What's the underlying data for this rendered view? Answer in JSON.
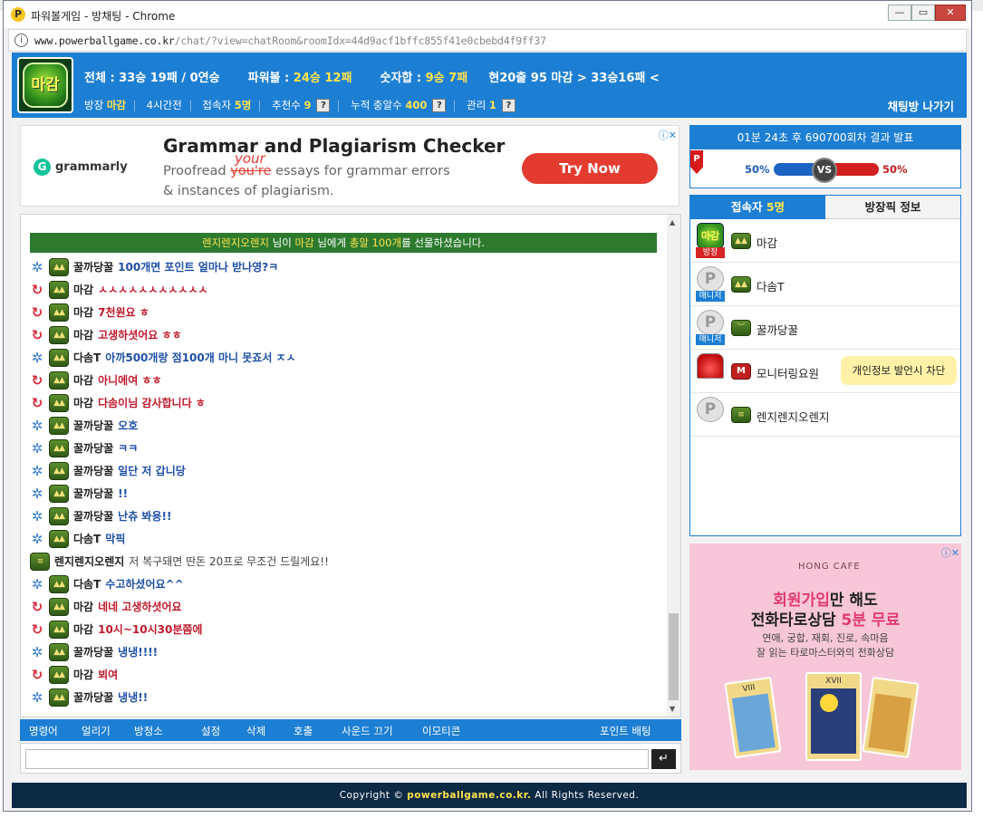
{
  "window": {
    "title": "파워볼게임 - 방채팅 - Chrome",
    "url_host": "www.powerballgame.co.kr",
    "url_path": "/chat/?view=chatRoom&roomIdx=44d9acf1bffc855f41e0cbebd4f9ff37",
    "min_glyph": "—",
    "max_glyph": "▭",
    "close_glyph": "✕"
  },
  "header": {
    "logo_text": "마감",
    "stat_total_label": "전체 : ",
    "stat_total_value": "33승 19패 / 0연승",
    "stat_powerball_label": "파워볼 : ",
    "stat_powerball_value": "24승 12패",
    "stat_numsum_label": "숫자합 : ",
    "stat_numsum_value": "9승 7패",
    "stat_current": "현20출 95 마감 > 33승16패 <",
    "room_owner_label": "방장",
    "room_owner_value": "마감",
    "mode": "4시간전",
    "connected_label": "접속자",
    "connected_value": "5명",
    "recommend_label": "추천수",
    "recommend_value": "9",
    "gift_label": "누적 충알수",
    "gift_value": "400",
    "manage_label": "관리",
    "manage_value": "1",
    "help_glyph": "?",
    "exit_button": "채팅방 나가기"
  },
  "ad_grammarly": {
    "brand": "grammarly",
    "brand_icon": "G",
    "headline": "Grammar and Plagiarism Checker",
    "line1_pre": "Proofread ",
    "line1_strike": "you're",
    "line1_post": " essays for grammar errors",
    "correction": "your",
    "line2": "& instances of plagiarism.",
    "cta": "Try Now",
    "adchoices": "ⓘ✕"
  },
  "gift_notice": {
    "sender": "렌지렌지오렌지",
    "part1": " 님이 ",
    "receiver": "마감",
    "part2": " 님에게 ",
    "item": "총알 100개",
    "part3": "를 선물하셨습니다."
  },
  "messages": [
    {
      "nick": "꿀까당꿀",
      "text": "100개면 포인트 얼마나 받나영?ㅋ",
      "lvl": "star",
      "color": "blue"
    },
    {
      "nick": "마감",
      "text": "ㅅㅅㅅㅅㅅㅅㅅㅅㅅㅅㅅ",
      "lvl": "swirl",
      "color": "red"
    },
    {
      "nick": "마감",
      "text": "7천원요 ㅎ",
      "lvl": "swirl",
      "color": "red"
    },
    {
      "nick": "마감",
      "text": "고생하셧어요 ㅎㅎ",
      "lvl": "swirl",
      "color": "red"
    },
    {
      "nick": "다솜T",
      "text": "아까500개랑 점100개 마니 못죠서 ㅈㅅ",
      "lvl": "star",
      "color": "blue"
    },
    {
      "nick": "마감",
      "text": "아니에여 ㅎㅎ",
      "lvl": "swirl",
      "color": "red"
    },
    {
      "nick": "마감",
      "text": "다솜이님 감사합니다 ㅎ",
      "lvl": "swirl",
      "color": "red"
    },
    {
      "nick": "꿀까당꿀",
      "text": "오호",
      "lvl": "star",
      "color": "blue"
    },
    {
      "nick": "꿀까당꿀",
      "text": "ㅋㅋ",
      "lvl": "star",
      "color": "blue"
    },
    {
      "nick": "꿀까당꿀",
      "text": "일단 저 갑니당",
      "lvl": "star",
      "color": "blue"
    },
    {
      "nick": "꿀까당꿀",
      "text": "!!",
      "lvl": "star",
      "color": "blue"
    },
    {
      "nick": "꿀까당꿀",
      "text": "난츄 봐용!!",
      "lvl": "star",
      "color": "blue"
    },
    {
      "nick": "다솜T",
      "text": "막픽",
      "lvl": "star",
      "color": "blue"
    },
    {
      "nick": "렌지렌지오렌지",
      "text": "저 복구돼면 딴돈 20프로 무조건 드릴게요!!",
      "lvl": "none",
      "color": "gray"
    },
    {
      "nick": "다솜T",
      "text": "수고하셨어요^^",
      "lvl": "star",
      "color": "blue"
    },
    {
      "nick": "마감",
      "text": "네네 고생하셧어요",
      "lvl": "swirl",
      "color": "red"
    },
    {
      "nick": "마감",
      "text": "10시~10시30분쯤에",
      "lvl": "swirl",
      "color": "red"
    },
    {
      "nick": "꿀까당꿀",
      "text": "냉냉!!!!",
      "lvl": "star",
      "color": "blue"
    },
    {
      "nick": "마감",
      "text": "뵈여",
      "lvl": "swirl",
      "color": "red"
    },
    {
      "nick": "꿀까당꿀",
      "text": "냉냉!!",
      "lvl": "star",
      "color": "blue"
    }
  ],
  "commands": [
    "명령어",
    "얼리기",
    "방청소",
    "설정",
    "삭제",
    "호출",
    "사운드 끄기",
    "이모티콘",
    "포인트 배팅"
  ],
  "send_glyph": "↵",
  "result": {
    "heading": "01분 24초 후 690700회차 결과 발표",
    "left_pct": "50%",
    "right_pct": "50%",
    "vs": "VS",
    "flag": "P"
  },
  "user_panel": {
    "tab_users_label": "접속자 ",
    "tab_users_count": "5명",
    "tab_info": "방장픽 정보",
    "users": [
      {
        "name": "마감",
        "role": "방장",
        "badge": "boss",
        "rank": "▲▲",
        "role_color": "red"
      },
      {
        "name": "다솜T",
        "role": "매니저",
        "badge": "p",
        "rank": "▲▲",
        "role_color": "blue"
      },
      {
        "name": "꿀까당꿀",
        "role": "매니저",
        "badge": "p",
        "rank": "︶",
        "role_color": "blue"
      },
      {
        "name": "모니터링요원",
        "role": "",
        "badge": "siren",
        "rank": "M",
        "role_color": ""
      },
      {
        "name": "렌지렌지오렌지",
        "role": "",
        "badge": "p",
        "rank": "≡",
        "role_color": ""
      }
    ],
    "tooltip": "개인정보 발언시 차단"
  },
  "ad_tarot": {
    "brand": "HONG CAFE",
    "h1_a": "회원가입",
    "h1_b": "만 해도",
    "h2_a": "전화타로상담 ",
    "h2_b": "5분 무료",
    "s1": "연애, 궁합, 재회, 진로, 속마음",
    "s2": "잘 읽는 타로마스터와의 전화상담",
    "adchoices": "ⓘ✕",
    "cards": [
      "VIII",
      "XVII",
      ""
    ]
  },
  "footer": {
    "pre": "Copyright © ",
    "site": "powerballgame.co.kr.",
    "post": " All Rights Reserved."
  },
  "colors": {
    "primary": "#1d7fd3",
    "accent_yellow": "#ffe34d",
    "gift_green": "#2d7a2f",
    "footer": "#0d2a45"
  }
}
